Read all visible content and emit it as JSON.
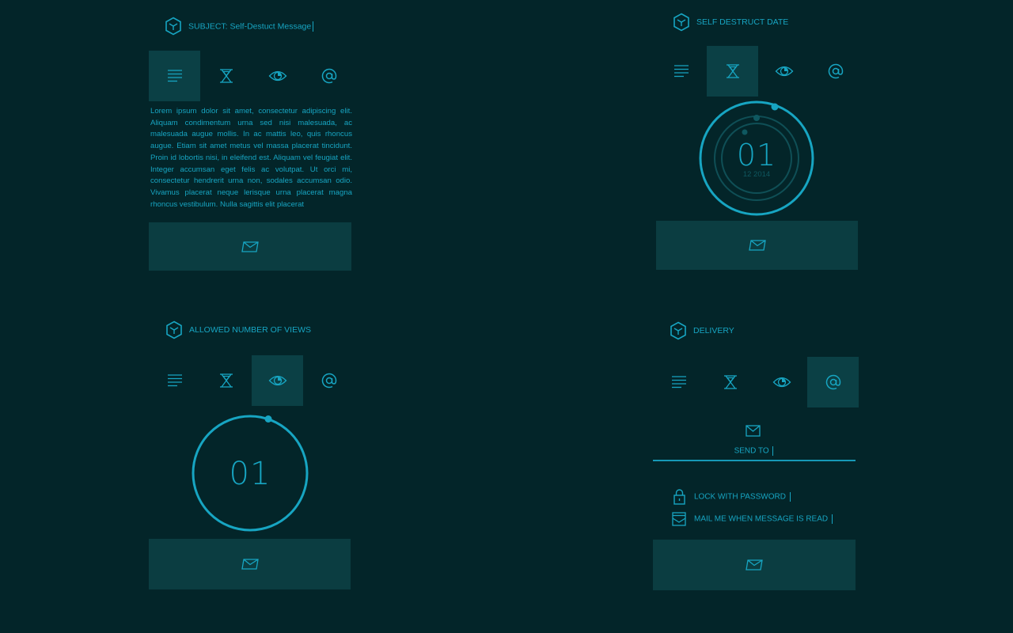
{
  "colors": {
    "background": "#032529",
    "accent": "#17a5c2",
    "tab_active": "#0b4045",
    "button": "#0b3d41",
    "dim_ring": "#0f4f56"
  },
  "tabs_icons": [
    "lines-icon",
    "hourglass-icon",
    "eye-icon",
    "at-icon"
  ],
  "panel_message": {
    "subject_label": "SUBJECT: Self-Destuct Message",
    "active_tab": 0,
    "body": "Lorem ipsum dolor sit amet, consectetur adipiscing elit. Aliquam condimentum urna sed nisi malesuada, ac malesuada augue mollis. In ac mattis leo, quis rhoncus augue. Etiam sit amet metus vel massa placerat tincidunt. Proin id lobortis nisi, in eleifend est. Aliquam vel feugiat elit. Integer accumsan eget felis ac volutpat. Ut orci mi, consectetur hendrerit urna non, sodales accumsan odio. Vivamus placerat neque lerisque urna placerat magna rhoncus vestibulum. Nulla sagittis elit placerat"
  },
  "panel_date": {
    "title": "SELF DESTRUCT DATE",
    "active_tab": 1,
    "day": "01",
    "month_year": "12 2014"
  },
  "panel_views": {
    "title": "ALLOWED NUMBER OF VIEWS",
    "active_tab": 2,
    "count": "01"
  },
  "panel_delivery": {
    "title": "DELIVERY",
    "active_tab": 3,
    "send_to_label": "SEND TO",
    "lock_label": "LOCK WITH PASSWORD",
    "notify_label": "MAIL ME WHEN MESSAGE IS READ"
  }
}
